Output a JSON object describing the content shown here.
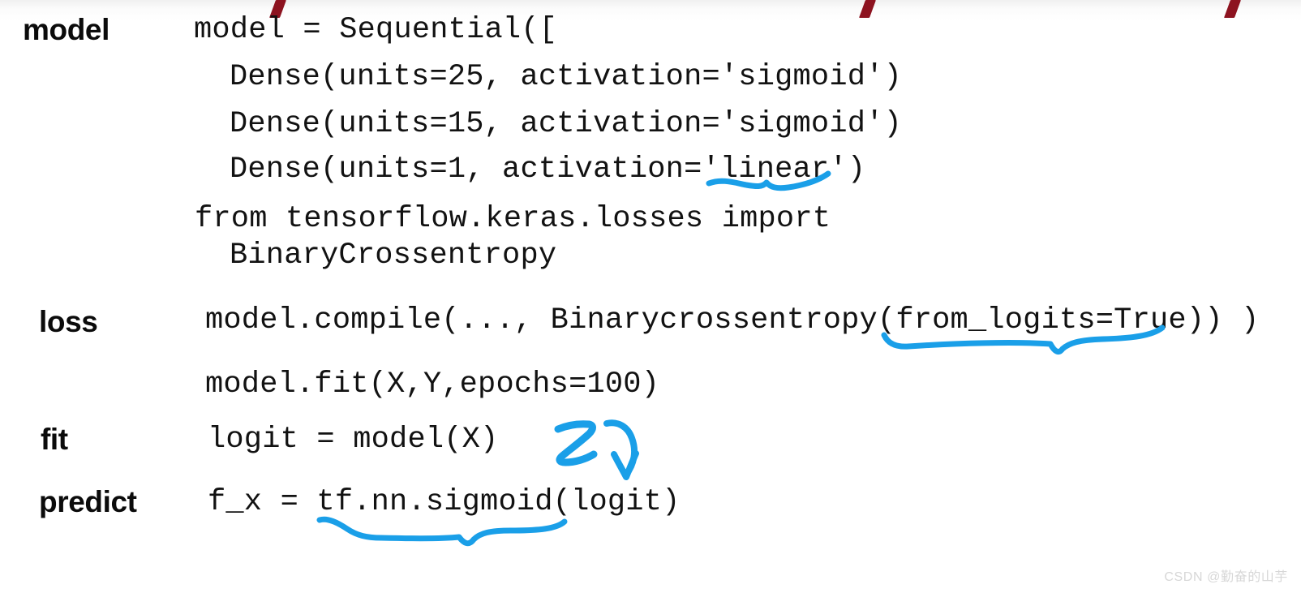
{
  "slide": {
    "background_color": "#ffffff",
    "code_color": "#121212",
    "label_color": "#0b0b0b",
    "annotation_color": "#1a9fe8",
    "tick_color": "#8d1320",
    "watermark_color": "#d7d7d7"
  },
  "labels": {
    "model": "model",
    "loss": "loss",
    "fit": "fit",
    "predict": "predict"
  },
  "code": {
    "line1": "model = Sequential([",
    "line2": "Dense(units=25, activation='sigmoid')",
    "line3": "Dense(units=15, activation='sigmoid')",
    "line4": "Dense(units=1, activation='linear')",
    "line5": "from tensorflow.keras.losses import",
    "line6": "BinaryCrossentropy",
    "line7": "model.compile(..., Binarycrossentropy(from_logits=True)) )",
    "line8": "model.fit(X,Y,epochs=100)",
    "line9": "logit = model(X)",
    "line10": "f_x = tf.nn.sigmoid(logit)"
  },
  "annotations": {
    "underline_linear": "blue-underline-linear",
    "underline_from_logits": "blue-underline-from-logits",
    "underline_sigmoid_logit": "blue-underline-sigmoid-logit",
    "handwritten_z": "z",
    "arrow": "curved-down-arrow"
  },
  "marks": {
    "tick1": "red-tick-mark",
    "tick2": "red-tick-mark",
    "tick3": "red-tick-mark"
  },
  "watermark": {
    "text": "CSDN @勤奋的山芋"
  }
}
